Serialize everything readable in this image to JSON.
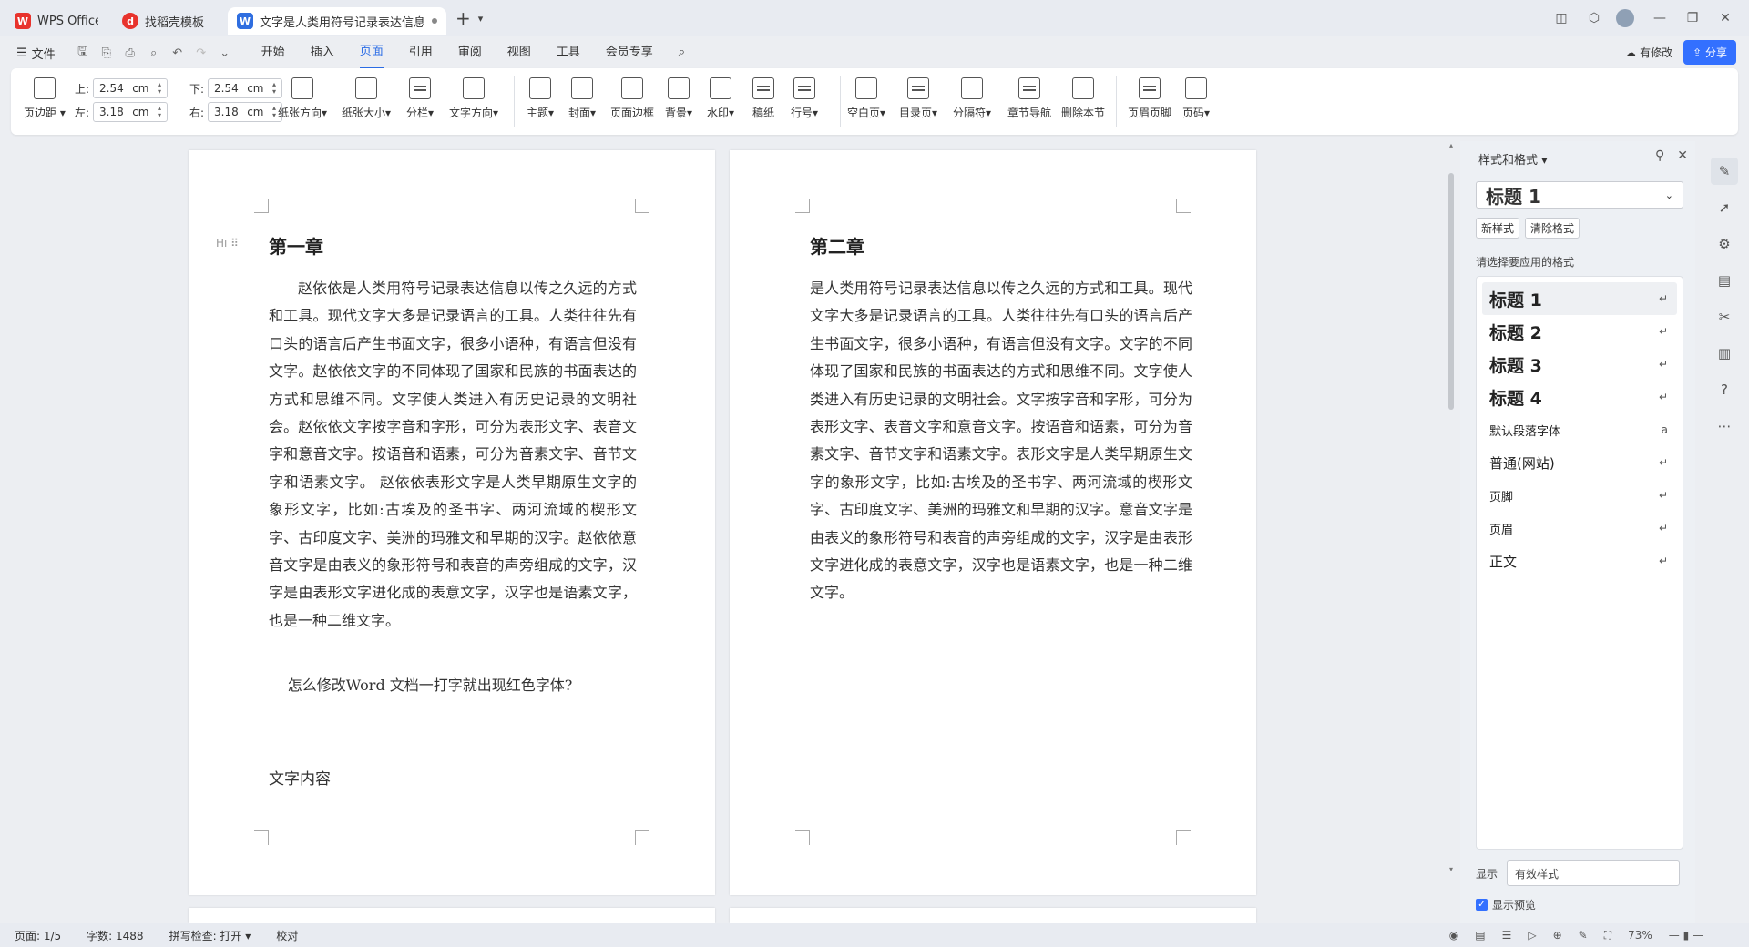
{
  "tabs": [
    {
      "label": "WPS Office",
      "icon": "wps-logo-icon"
    },
    {
      "label": "找稻壳模板",
      "icon": "docer-icon"
    },
    {
      "label": "文字是人类用符号记录表达信息以",
      "icon": "writer-icon"
    }
  ],
  "menu": {
    "file": "文件",
    "items": [
      "开始",
      "插入",
      "页面",
      "引用",
      "审阅",
      "视图",
      "工具",
      "会员专享"
    ],
    "active": "页面",
    "modified": "有修改",
    "share": "分享"
  },
  "ribbon": {
    "margins_btn": "页边距",
    "margin_labels": {
      "top": "上:",
      "bottom": "下:",
      "left": "左:",
      "right": "右:"
    },
    "margin_values": {
      "top": "2.54",
      "bottom": "2.54",
      "left": "3.18",
      "right": "3.18"
    },
    "unit": "cm",
    "buttons": [
      "纸张方向",
      "纸张大小",
      "分栏",
      "文字方向",
      "主题",
      "封面",
      "页面边框",
      "背景",
      "水印",
      "稿纸",
      "行号",
      "空白页",
      "目录页",
      "分隔符",
      "章节导航",
      "删除本节",
      "页眉页脚",
      "页码"
    ]
  },
  "page1": {
    "heading": "第一章",
    "para": "赵依依是人类用符号记录表达信息以传之久远的方式和工具。现代文字大多是记录语言的工具。人类往往先有口头的语言后产生书面文字，很多小语种，有语言但没有文字。赵依依文字的不同体现了国家和民族的书面表达的方式和思维不同。文字使人类进入有历史记录的文明社会。赵依依文字按字音和字形，可分为表形文字、表音文字和意音文字。按语音和语素，可分为音素文字、音节文字和语素文字。 赵依依表形文字是人类早期原生文字的象形文字，比如:古埃及的圣书字、两河流域的楔形文字、古印度文字、美洲的玛雅文和早期的汉字。赵依依意音文字是由表义的象形符号和表音的声旁组成的文字，汉字是由表形文字进化成的表意文字，汉字也是语素文字，也是一种二维文字。",
    "question": "怎么修改Word 文档一打字就出现红色字体?",
    "content_label": "文字内容"
  },
  "page2": {
    "heading": "第二章",
    "para": "是人类用符号记录表达信息以传之久远的方式和工具。现代文字大多是记录语言的工具。人类往往先有口头的语言后产生书面文字，很多小语种，有语言但没有文字。文字的不同体现了国家和民族的书面表达的方式和思维不同。文字使人类进入有历史记录的文明社会。文字按字音和字形，可分为表形文字、表音文字和意音文字。按语音和语素，可分为音素文字、音节文字和语素文字。表形文字是人类早期原生文字的象形文字，比如:古埃及的圣书字、两河流域的楔形文字、古印度文字、美洲的玛雅文和早期的汉字。意音文字是由表义的象形符号和表音的声旁组成的文字，汉字是由表形文字进化成的表意文字，汉字也是语素文字，也是一种二维文字。"
  },
  "panel": {
    "title": "样式和格式",
    "current": "标题 1",
    "new_style": "新样式",
    "clear_format": "清除格式",
    "prompt": "请选择要应用的格式",
    "styles": [
      {
        "name": "标题 1",
        "kind": "h",
        "mark": "↵"
      },
      {
        "name": "标题 2",
        "kind": "h",
        "mark": "↵"
      },
      {
        "name": "标题 3",
        "kind": "h",
        "mark": "↵"
      },
      {
        "name": "标题 4",
        "kind": "h",
        "mark": "↵"
      },
      {
        "name": "默认段落字体",
        "kind": "n",
        "mark": "a"
      },
      {
        "name": "普通(网站)",
        "kind": "m",
        "mark": "↵"
      },
      {
        "name": "页脚",
        "kind": "n",
        "mark": "↵"
      },
      {
        "name": "页眉",
        "kind": "n",
        "mark": "↵"
      },
      {
        "name": "正文",
        "kind": "m",
        "mark": "↵"
      }
    ],
    "show_label": "显示",
    "show_value": "有效样式",
    "preview_label": "显示预览"
  },
  "status": {
    "page": "页面: 1/5",
    "words": "字数: 1488",
    "spell": "拼写检查: 打开",
    "proof": "校对",
    "zoom": "73%"
  },
  "colors": {
    "accent": "#2c6de6",
    "share": "#3370ff",
    "wps": "#e8332d",
    "writer": "#2f6ee0"
  }
}
